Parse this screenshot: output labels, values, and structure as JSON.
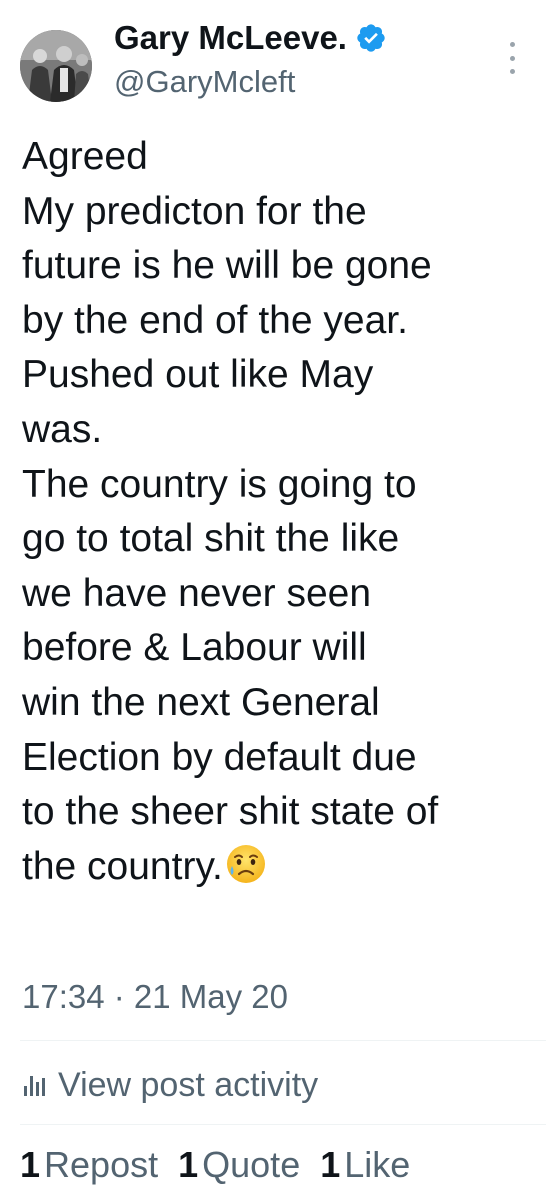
{
  "author": {
    "display_name": "Gary McLeeve.",
    "handle": "@GaryMcleft",
    "verified": true,
    "avatar_icon": "profile-photo"
  },
  "post": {
    "lines": [
      "Agreed",
      "My predicton for the",
      "future is he will be gone",
      "by the end of the year.",
      "Pushed out like May",
      "was.",
      "The country is going to",
      "go to total shit the like",
      "we have never seen",
      "before & Labour will",
      "win the next General",
      "Election by default due",
      "to the sheer shit state of",
      "the country."
    ],
    "trailing_emoji": "sad-but-relieved-face-emoji"
  },
  "timestamp": "17:34 · 21 May 20",
  "activity": {
    "label": "View post activity",
    "icon": "analytics-bars-icon"
  },
  "stats": {
    "reposts": {
      "count": "1",
      "label": "Repost"
    },
    "quotes": {
      "count": "1",
      "label": "Quote"
    },
    "likes": {
      "count": "1",
      "label": "Like"
    }
  },
  "colors": {
    "text_primary": "#0f1419",
    "text_secondary": "#536471",
    "verified_blue": "#1d9bf0",
    "divider": "#eff3f4"
  }
}
